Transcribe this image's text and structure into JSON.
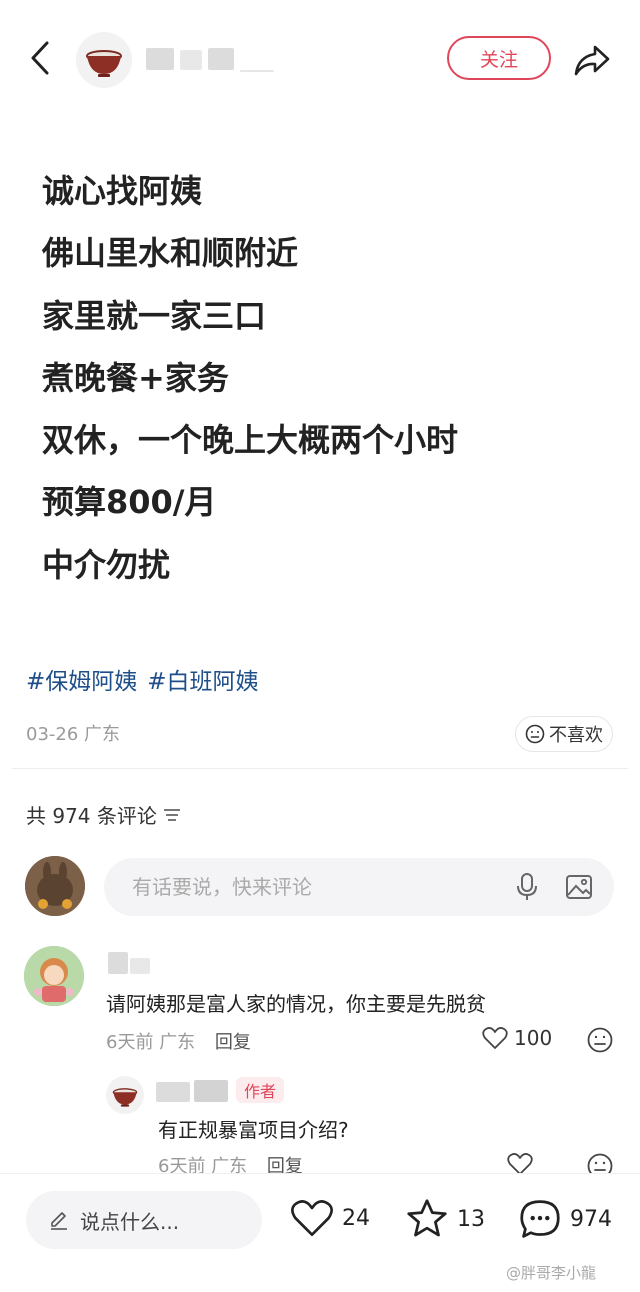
{
  "header": {
    "follow_label": "关注"
  },
  "post": {
    "lines": [
      "诚心找阿姨",
      "佛山里水和顺附近",
      "家里就一家三口",
      "煮晚餐+家务",
      "双休，一个晚上大概两个小时",
      "预算800/月",
      "中介勿扰"
    ],
    "tags": [
      "#保姆阿姨",
      "#白班阿姨"
    ],
    "date": "03-26",
    "location": "广东",
    "dislike_label": "不喜欢"
  },
  "comments_section": {
    "count_label": "共 974 条评论",
    "input_placeholder": "有话要说，快来评论"
  },
  "comments": [
    {
      "text": "请阿姨那是富人家的情况，你主要是先脱贫",
      "time": "6天前",
      "location": "广东",
      "reply_label": "回复",
      "likes": "100"
    }
  ],
  "replies": [
    {
      "badge": "作者",
      "text": "有正规暴富项目介绍?",
      "time": "6天前",
      "location": "广东",
      "reply_label": "回复"
    }
  ],
  "bottom_bar": {
    "say_placeholder": "说点什么...",
    "likes": "24",
    "favorites": "13",
    "comments": "974"
  },
  "watermark": "@胖哥李小龍",
  "colors": {
    "accent": "#e0465a",
    "tag": "#1f4f8a"
  }
}
